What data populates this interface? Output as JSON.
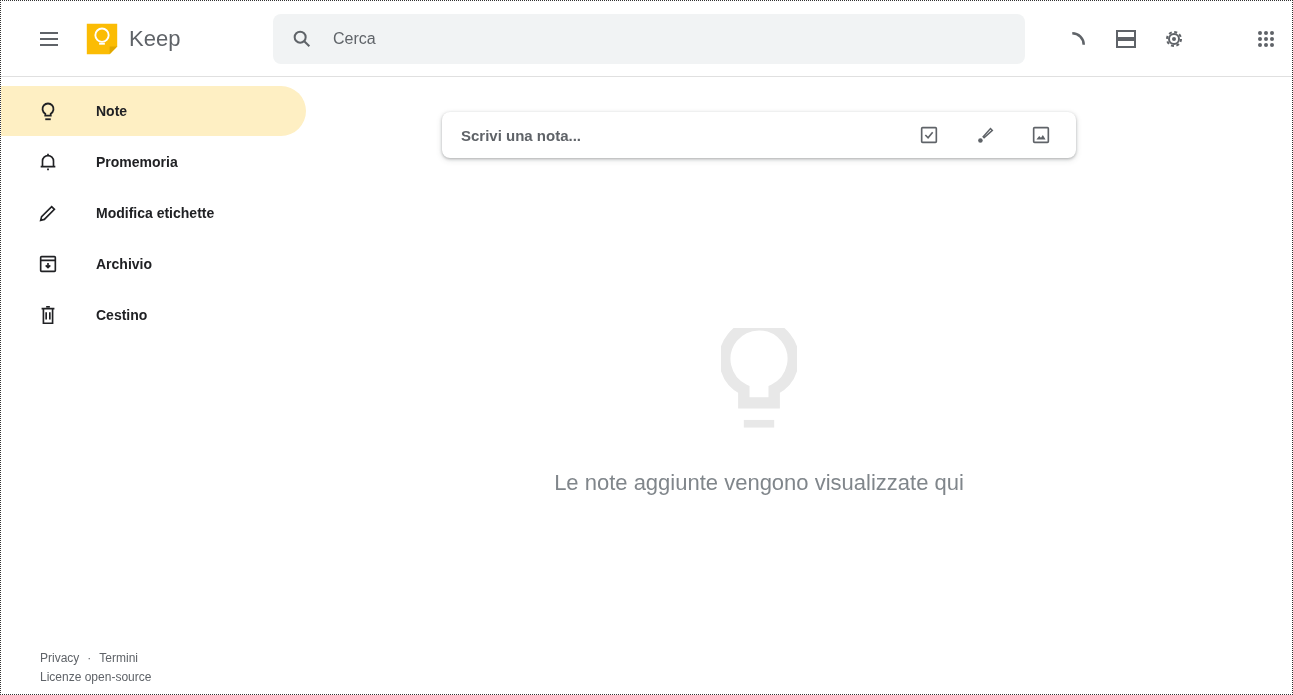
{
  "header": {
    "app_name": "Keep",
    "search": {
      "placeholder": "Cerca"
    }
  },
  "sidebar": {
    "items": [
      {
        "label": "Note",
        "kind": "bulb",
        "selected": true
      },
      {
        "label": "Promemoria",
        "kind": "bell",
        "selected": false
      },
      {
        "label": "Modifica etichette",
        "kind": "pencil",
        "selected": false
      },
      {
        "label": "Archivio",
        "kind": "archive",
        "selected": false
      },
      {
        "label": "Cestino",
        "kind": "trash",
        "selected": false
      }
    ],
    "footer": {
      "links": [
        "Privacy",
        "Termini"
      ],
      "separator": "·",
      "license": "Licenze open-source"
    }
  },
  "note_input": {
    "placeholder": "Scrivi una nota..."
  },
  "empty_state": {
    "message": "Le note aggiunte vengono visualizzate qui"
  }
}
